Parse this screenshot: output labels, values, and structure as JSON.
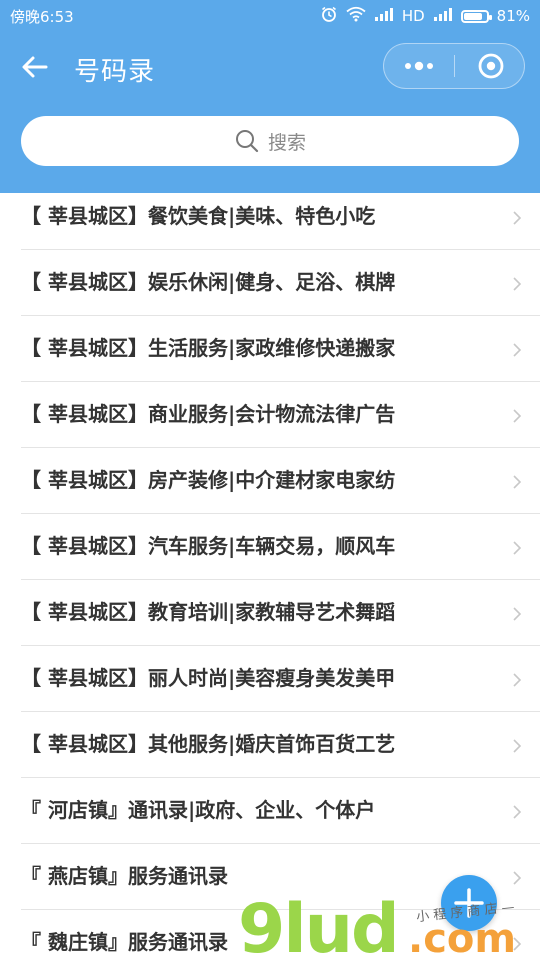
{
  "status_bar": {
    "time": "傍晚6:53",
    "network": "HD",
    "battery": "81%",
    "battery_level": 0.81
  },
  "nav": {
    "title": "号码录",
    "back_icon": "arrow-left-icon",
    "more_icon": "more-dots-icon",
    "close_icon": "target-circle-icon"
  },
  "search": {
    "placeholder": "搜索",
    "icon": "search-icon"
  },
  "list": {
    "items": [
      {
        "label": "【 莘县城区】餐饮美食|美味、特色小吃"
      },
      {
        "label": "【 莘县城区】娱乐休闲|健身、足浴、棋牌"
      },
      {
        "label": "【 莘县城区】生活服务|家政维修快递搬家"
      },
      {
        "label": "【 莘县城区】商业服务|会计物流法律广告"
      },
      {
        "label": "【 莘县城区】房产装修|中介建材家电家纺"
      },
      {
        "label": "【 莘县城区】汽车服务|车辆交易，顺风车"
      },
      {
        "label": "【 莘县城区】教育培训|家教辅导艺术舞蹈"
      },
      {
        "label": "【 莘县城区】丽人时尚|美容瘦身美发美甲"
      },
      {
        "label": "【 莘县城区】其他服务|婚庆首饰百货工艺"
      },
      {
        "label": "『 河店镇』通讯录|政府、企业、个体户"
      },
      {
        "label": "『 燕店镇』服务通讯录"
      },
      {
        "label": "『 魏庄镇』服务通讯录"
      }
    ],
    "chevron_icon": "chevron-right-icon"
  },
  "fab": {
    "icon": "plus-icon"
  },
  "watermark": {
    "text": "9lud.com",
    "tagline": "小程序商店"
  },
  "colors": {
    "header_bg": "#5ba9ea",
    "fab_bg": "#3aa0ee",
    "item_text": "#333333",
    "divider": "#e4e4e4",
    "watermark_green": "#9bd64a",
    "watermark_orange": "#f4a13a"
  }
}
